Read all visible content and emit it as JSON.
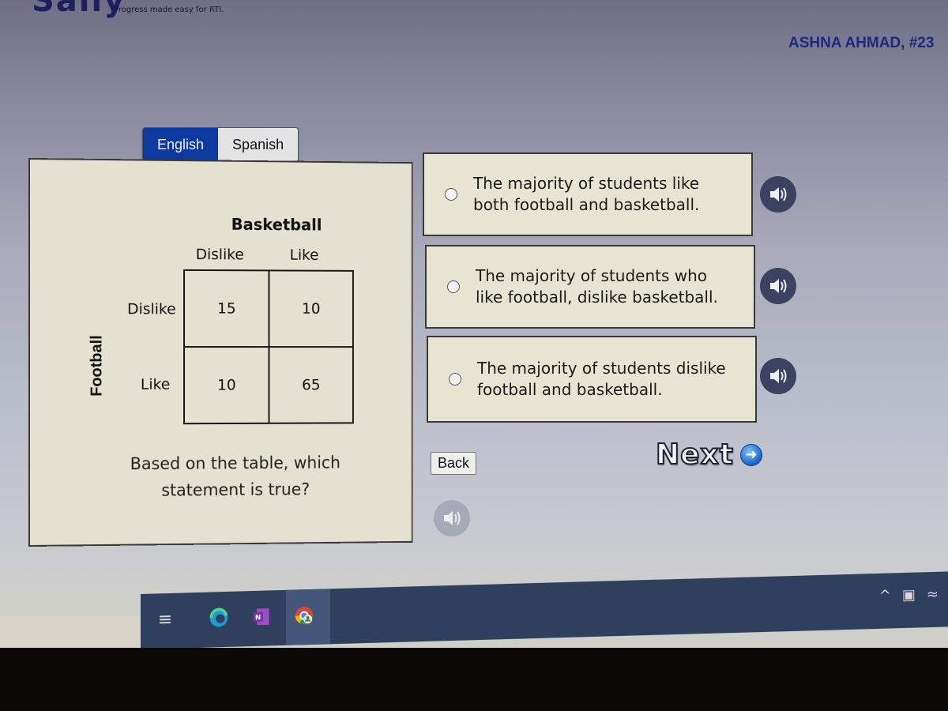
{
  "header": {
    "tagline": "Progress made easy for RTI.",
    "student_label": "ASHNA AHMAD, #23"
  },
  "language_toggle": {
    "options": [
      {
        "label": "English",
        "selected": true
      },
      {
        "label": "Spanish",
        "selected": false
      }
    ]
  },
  "question": {
    "table": {
      "column_variable": "Basketball",
      "row_variable": "Football",
      "column_headers": [
        "Dislike",
        "Like"
      ],
      "row_headers": [
        "Dislike",
        "Like"
      ],
      "cells": [
        [
          "15",
          "10"
        ],
        [
          "10",
          "65"
        ]
      ]
    },
    "prompt": "Based on the table, which statement is true?"
  },
  "answers": [
    {
      "text": "The majority of students like both football and basketball.",
      "selected": false
    },
    {
      "text": "The majority of students who like football, dislike basketball.",
      "selected": false
    },
    {
      "text": "The majority of students dislike football and basketball.",
      "selected": false
    }
  ],
  "navigation": {
    "back_label": "Back",
    "next_label": "Next"
  },
  "icons": {
    "speaker": "speaker-icon",
    "next_arrow": "arrow-right-circle-icon"
  },
  "colors": {
    "english_active": "#0d3aa0",
    "student_name": "#1b2a80",
    "panel_bg": "#e4e1d0",
    "speaker_bg": "#3d4260",
    "taskbar": "#2f3f5e"
  },
  "taskbar": {
    "apps": [
      "Task View",
      "Microsoft Edge",
      "OneNote",
      "Chrome"
    ],
    "onenote_letter": "N"
  }
}
